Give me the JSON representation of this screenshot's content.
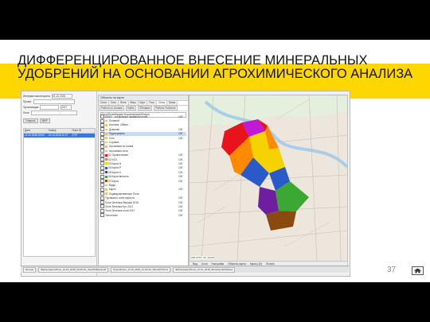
{
  "slide": {
    "title": "ДИФФЕРЕНЦИРОВАННОЕ ВНЕСЕНИЕ МИНЕРАЛЬНЫХ УДОБРЕНИЙ НА ОСНОВАНИИ АГРОХИМИЧЕСКОГО АНАЛИЗА",
    "page_number": "37",
    "band_color": "#ffd700",
    "home_icon": "home-icon"
  },
  "left_pane": {
    "rows": [
      {
        "label": "Интервал мониторинга",
        "value": "01.10.2018"
      },
      {
        "label": "Проект",
        "value": ""
      },
      {
        "label": "Организация",
        "value": "2017"
      },
      {
        "label": "Поле",
        "value": ""
      }
    ],
    "buttons": [
      "Открыть",
      "WKP"
    ],
    "table_headers": [
      "Дата",
      "Номер",
      "Поле ID"
    ],
    "selected_row": [
      "12.10.2018 09:00",
      "12.10.2018 11:07",
      "2727"
    ]
  },
  "panel": {
    "title": "Объекты на карте",
    "tabs": [
      "Слои",
      "Сеть",
      "Поле",
      "Маш",
      "Карт",
      "Геос",
      "Слои",
      "Треки"
    ],
    "toolbar": [
      "Работа со слоями",
      "Найти",
      "Обновить",
      "Работы ГеоБитек"
    ],
    "layer_field": "СлоиПоляФермер ВоронежскаяОбласть",
    "tree": [
      {
        "name": "KMXY - отображать названия полей",
        "value": "100",
        "kind": "check"
      },
      {
        "name": "Полевой",
        "value": "",
        "kind": "folder"
      },
      {
        "name": "Агрохим. Обмен",
        "value": "",
        "kind": "folder"
      },
      {
        "name": "Доминан",
        "value": "100",
        "kind": "folder"
      },
      {
        "name": "Гидрография",
        "value": "100",
        "kind": "folder",
        "selected": true
      },
      {
        "name": "Сеть",
        "value": "100",
        "kind": "folder"
      },
      {
        "name": "Сорняки",
        "value": "",
        "kind": "folder"
      },
      {
        "name": "Агрохимия по полям",
        "value": "",
        "kind": "folder"
      },
      {
        "name": "Агрохимия поля",
        "value": "",
        "kind": "folder"
      },
      {
        "name": "01 Органические",
        "value": "100",
        "kind": "swatch",
        "color": "#d81d1d"
      },
      {
        "name": "02 NO3",
        "value": "100",
        "kind": "swatch",
        "color": "#ff7a00"
      },
      {
        "name": "03 Карта N",
        "value": "100",
        "kind": "swatch",
        "color": "#f0d800"
      },
      {
        "name": "04 Карта P",
        "value": "100",
        "kind": "swatch",
        "color": "#2a56c9"
      },
      {
        "name": "05 Карта K",
        "value": "100",
        "kind": "swatch",
        "color": "#6b2a9a"
      },
      {
        "name": "06 Карта вносить",
        "value": "100",
        "kind": "swatch",
        "color": "#3aaa35"
      },
      {
        "name": "07 Карта",
        "value": "100",
        "kind": "swatch",
        "color": "#8a4a10"
      },
      {
        "name": "Виды",
        "value": "",
        "kind": "folder"
      },
      {
        "name": "Карта",
        "value": "100",
        "kind": "folder"
      },
      {
        "name": "Подведомственные Поля",
        "value": "",
        "kind": "folder"
      },
      {
        "name": "Туровского поля проекта",
        "value": "100",
        "kind": "check"
      },
      {
        "name": "Поле Зеленые Вершки 2018",
        "value": "100",
        "kind": "check"
      },
      {
        "name": "Поле Зеленые Кут 2017",
        "value": "100",
        "kind": "check"
      },
      {
        "name": "Поле Зеленые поля 2017",
        "value": "100",
        "kind": "check"
      },
      {
        "name": "Тепличное",
        "value": "100",
        "kind": "check"
      }
    ]
  },
  "map": {
    "coord_readout": "WB АГРП: 39, 25100",
    "toolbar": [
      "Вид",
      "Слои",
      "Настройки",
      "Объекты карты",
      "Карта (10)",
      "Печать"
    ]
  },
  "taskbar": {
    "items": [
      "Интерн",
      "ФайлыпакетаПоле_12.10_2018_09-00-51_ЗонаПоВнесенИ",
      "ТрассаПоле_12.10_2018_10-00-12_ЗатемПоПоле",
      "ФайлыпакетаПоле_12.10_2018_ФнимпортЕОКЗона"
    ]
  }
}
